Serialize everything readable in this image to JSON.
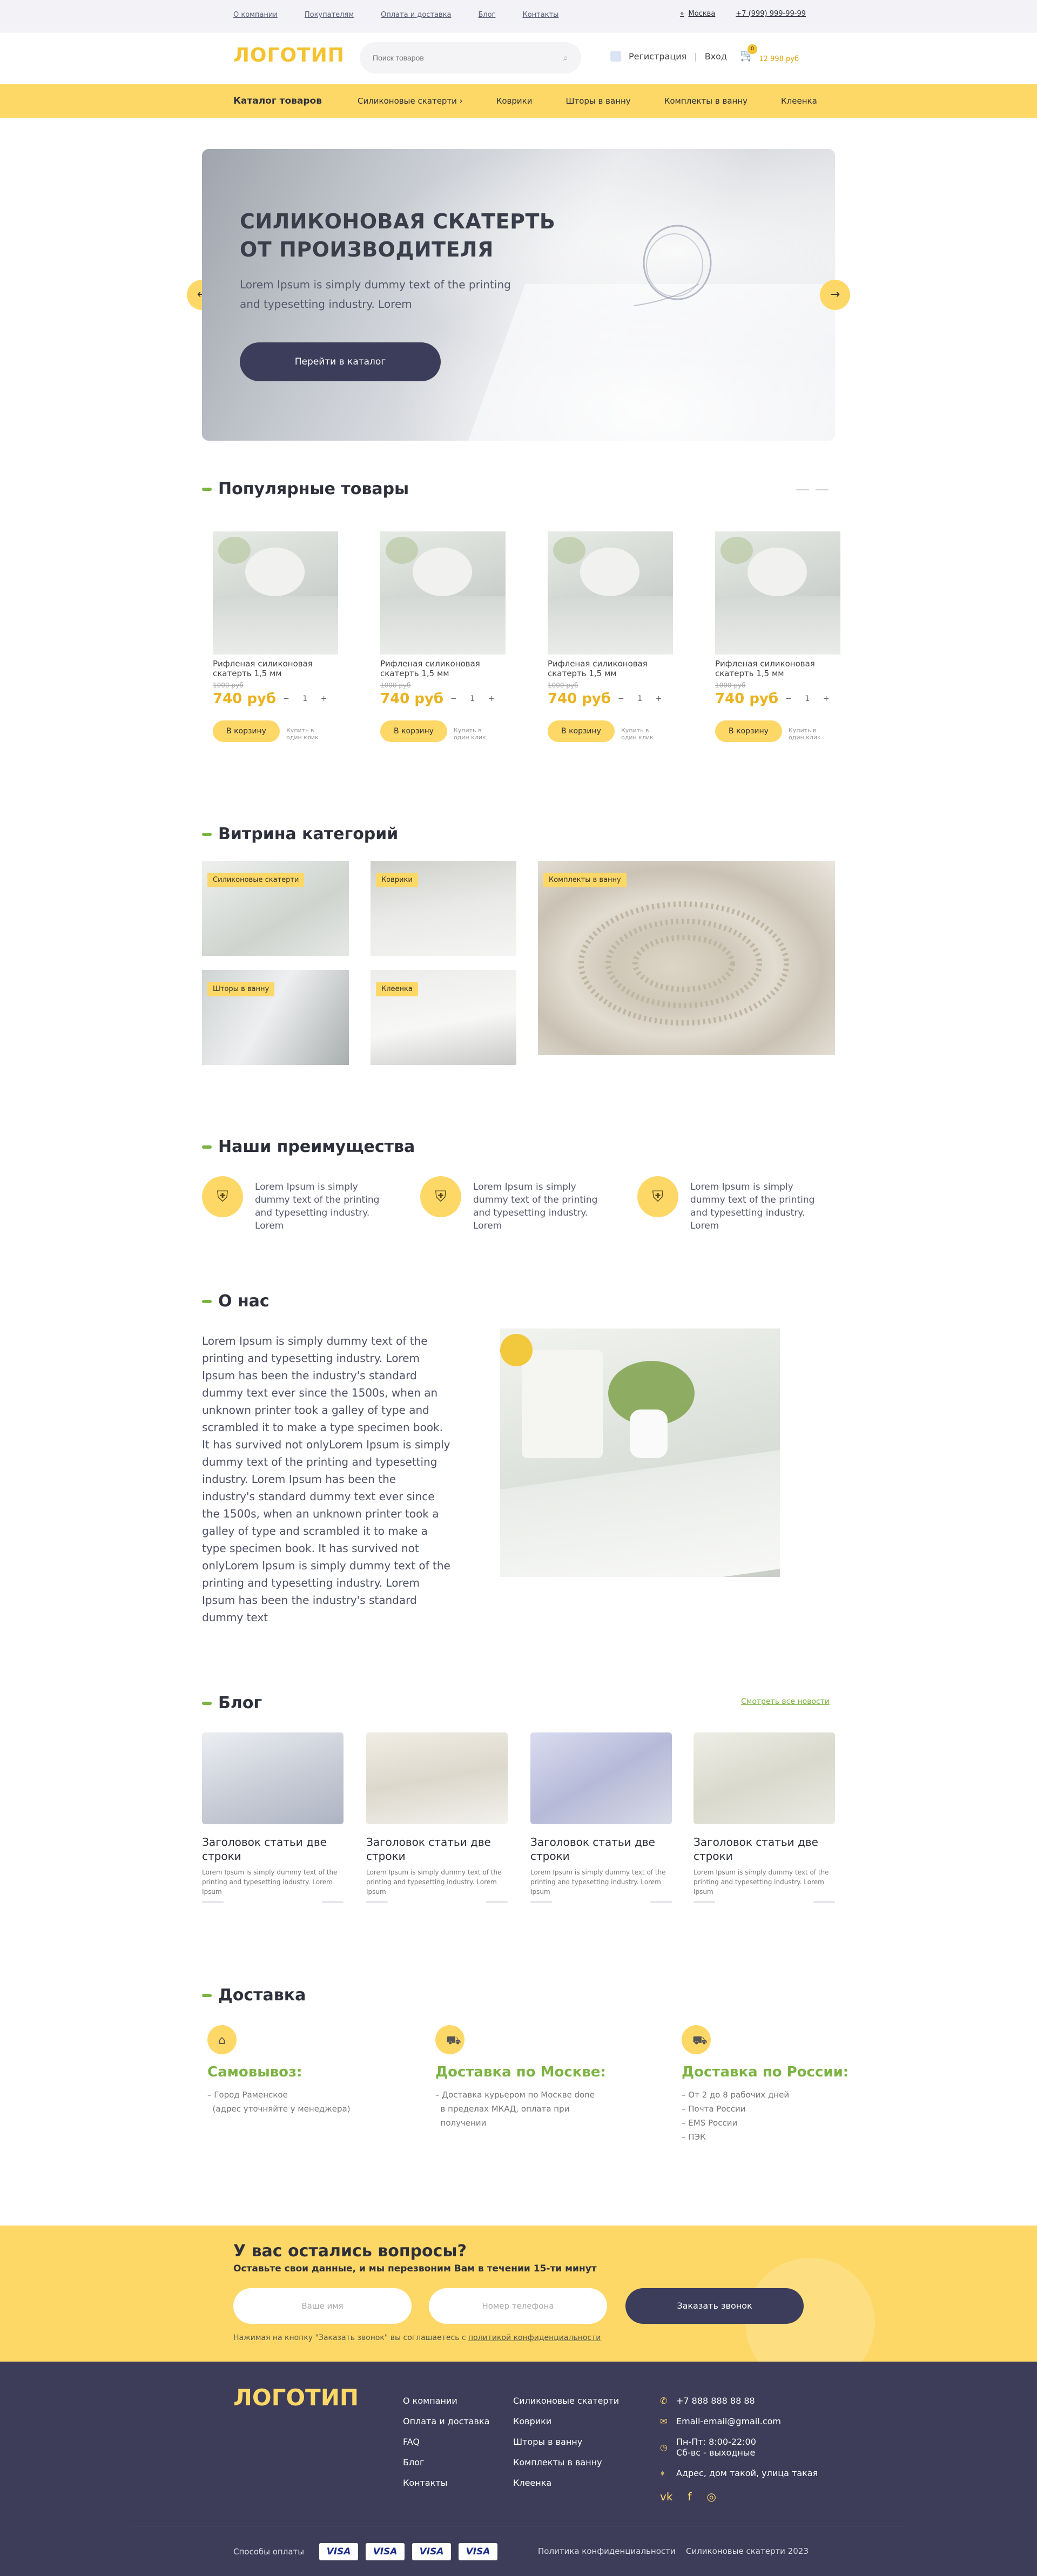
{
  "topbar": {
    "links": [
      "О компании",
      "Покупателям",
      "Оплата и доставка",
      "Блог",
      "Контакты"
    ],
    "city": "Москва",
    "phone": "+7 (999) 999-99-99"
  },
  "header": {
    "logo": "ЛОГОТИП",
    "search_placeholder": "Поиск товаров",
    "register": "Регистрация",
    "login": "Вход",
    "cart_count": "0",
    "cart_sum": "12 998 руб"
  },
  "nav": {
    "catalog": "Каталог товаров",
    "items": [
      "Силиконовые скатерти",
      "Коврики",
      "Шторы в ванну",
      "Комплекты в ванну",
      "Клеенка"
    ]
  },
  "hero": {
    "title_1": "СИЛИКОНОВАЯ СКАТЕРТЬ",
    "title_2": "ОТ ПРОИЗВОДИТЕЛЯ",
    "text": "Lorem Ipsum is simply dummy text of the printing and typesetting industry. Lorem",
    "button": "Перейти в каталог"
  },
  "popular": {
    "title": "Популярные товары",
    "products": [
      {
        "name": "Рифленая силиконовая скатерть 1,5 мм",
        "old": "1000 руб",
        "price": "740 руб",
        "qty": "1",
        "buy": "В корзину",
        "oneclick": "Купить в один клик"
      },
      {
        "name": "Рифленая силиконовая скатерть 1,5 мм",
        "old": "1000 руб",
        "price": "740 руб",
        "qty": "1",
        "buy": "В корзину",
        "oneclick": "Купить в один клик"
      },
      {
        "name": "Рифленая силиконовая скатерть 1,5 мм",
        "old": "1000 руб",
        "price": "740 руб",
        "qty": "1",
        "buy": "В корзину",
        "oneclick": "Купить в один клик"
      },
      {
        "name": "Рифленая силиконовая скатерть 1,5 мм",
        "old": "1000 руб",
        "price": "740 руб",
        "qty": "1",
        "buy": "В корзину",
        "oneclick": "Купить в один клик"
      }
    ]
  },
  "categories": {
    "title": "Витрина категорий",
    "items": [
      "Силиконовые скатерти",
      "Коврики",
      "Комплекты в ванну",
      "Шторы в ванну",
      "Клеенка"
    ]
  },
  "advantages": {
    "title": "Наши преимущества",
    "items": [
      "Lorem Ipsum is simply dummy text of the printing and typesetting industry. Lorem",
      "Lorem Ipsum is simply dummy text of the printing and typesetting industry. Lorem",
      "Lorem Ipsum is simply dummy text of the printing and typesetting industry. Lorem"
    ]
  },
  "about": {
    "title": "О нас",
    "text": "Lorem Ipsum is simply dummy text of the printing and typesetting industry. Lorem Ipsum has been the industry's standard dummy text ever since the 1500s, when an unknown printer took a galley of type and scrambled it to make a type specimen book. It has survived not onlyLorem Ipsum is simply dummy text of the printing and typesetting industry. Lorem Ipsum has been the industry's standard dummy text ever since the 1500s, when an unknown printer took a galley of type and scrambled it to make a type specimen book. It has survived not onlyLorem Ipsum is simply dummy text of the printing and typesetting industry. Lorem Ipsum has been the industry's standard dummy text"
  },
  "blog": {
    "title": "Блог",
    "all": "Смотреть все новости",
    "posts": [
      {
        "title": "Заголовок статьи две строки",
        "text": "Lorem Ipsum is simply dummy text of the printing and typesetting industry. Lorem Ipsum"
      },
      {
        "title": "Заголовок статьи две строки",
        "text": "Lorem Ipsum is simply dummy text of the printing and typesetting industry. Lorem Ipsum"
      },
      {
        "title": "Заголовок статьи две строки",
        "text": "Lorem Ipsum is simply dummy text of the printing and typesetting industry. Lorem Ipsum"
      },
      {
        "title": "Заголовок статьи две строки",
        "text": "Lorem Ipsum is simply dummy text of the printing and typesetting industry. Lorem Ipsum"
      }
    ]
  },
  "delivery": {
    "title": "Доставка",
    "cols": [
      {
        "title": "Самовывоз:",
        "lines": [
          "Город Раменское",
          "(адрес уточняйте у менеджера)"
        ]
      },
      {
        "title": "Доставка по Москве:",
        "lines": [
          "Доставка курьером по Москве done",
          "в пределах МКАД, оплата при",
          "получении"
        ]
      },
      {
        "title": "Доставка по России:",
        "lines": [
          "От 2 до 8 рабочих дней",
          "Почта России",
          "EMS России",
          "ПЭК"
        ]
      }
    ]
  },
  "callback": {
    "title": "У вас остались вопросы?",
    "subtitle": "Оставьте свои данные, и мы перезвоним Вам в течении 15-ти минут",
    "name_placeholder": "Ваше имя",
    "phone_placeholder": "Номер телефона",
    "button": "Заказать звонок",
    "note_prefix": "Нажимая на кнопку \"Заказать звонок\" вы соглашаетесь с ",
    "note_link": "политикой конфиденциальности"
  },
  "footer": {
    "logo": "ЛОГОТИП",
    "col1": [
      "О компании",
      "Оплата и доставка",
      "FAQ",
      "Блог",
      "Контакты"
    ],
    "col2": [
      "Силиконовые скатерти",
      "Коврики",
      "Шторы в ванну",
      "Комплекты в ванну",
      "Клеенка"
    ],
    "phone": "+7 888 888 88 88",
    "email": "Email-email@gmail.com",
    "hours_1": "Пн-Пт: 8:00-22:00",
    "hours_2": "Сб-вс - выходные",
    "address": "Адрес, дом такой, улица такая",
    "payment_label": "Способы оплаты",
    "visa": "VISA",
    "policy": "Политика конфиденциальности",
    "copyright": "Силиконовые скатерти 2023"
  },
  "colors": {
    "accent": "#fdd867",
    "green": "#7cb342",
    "dark": "#3d3d59"
  }
}
